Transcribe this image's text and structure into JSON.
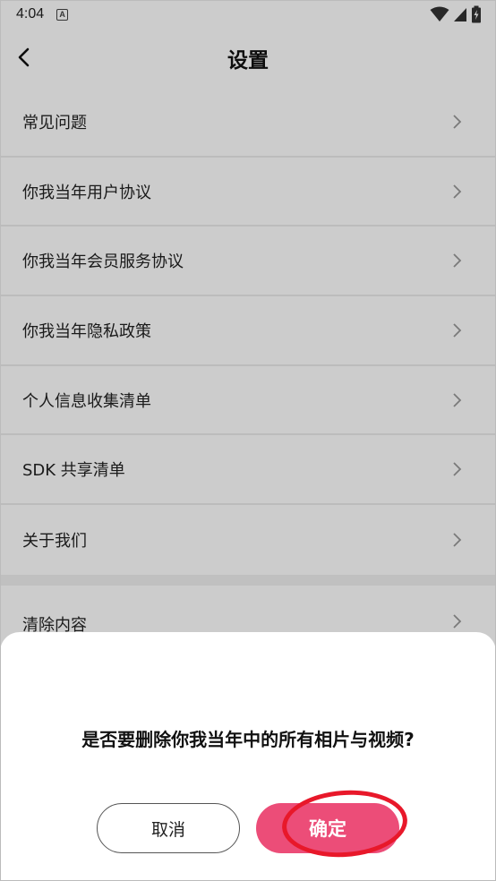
{
  "status_bar": {
    "time": "4:04",
    "notification_badge": "A"
  },
  "header": {
    "title": "设置"
  },
  "settings": {
    "items": [
      {
        "label": "常见问题"
      },
      {
        "label": "你我当年用户协议"
      },
      {
        "label": "你我当年会员服务协议"
      },
      {
        "label": "你我当年隐私政策"
      },
      {
        "label": "个人信息收集清单"
      },
      {
        "label": "SDK 共享清单"
      },
      {
        "label": "关于我们"
      }
    ],
    "clear_item": {
      "label": "清除内容"
    }
  },
  "dialog": {
    "message": "是否要删除你我当年中的所有相片与视频?",
    "cancel_label": "取消",
    "confirm_label": "确定"
  },
  "colors": {
    "accent": "#ec4d78",
    "highlight": "#e8182a"
  }
}
